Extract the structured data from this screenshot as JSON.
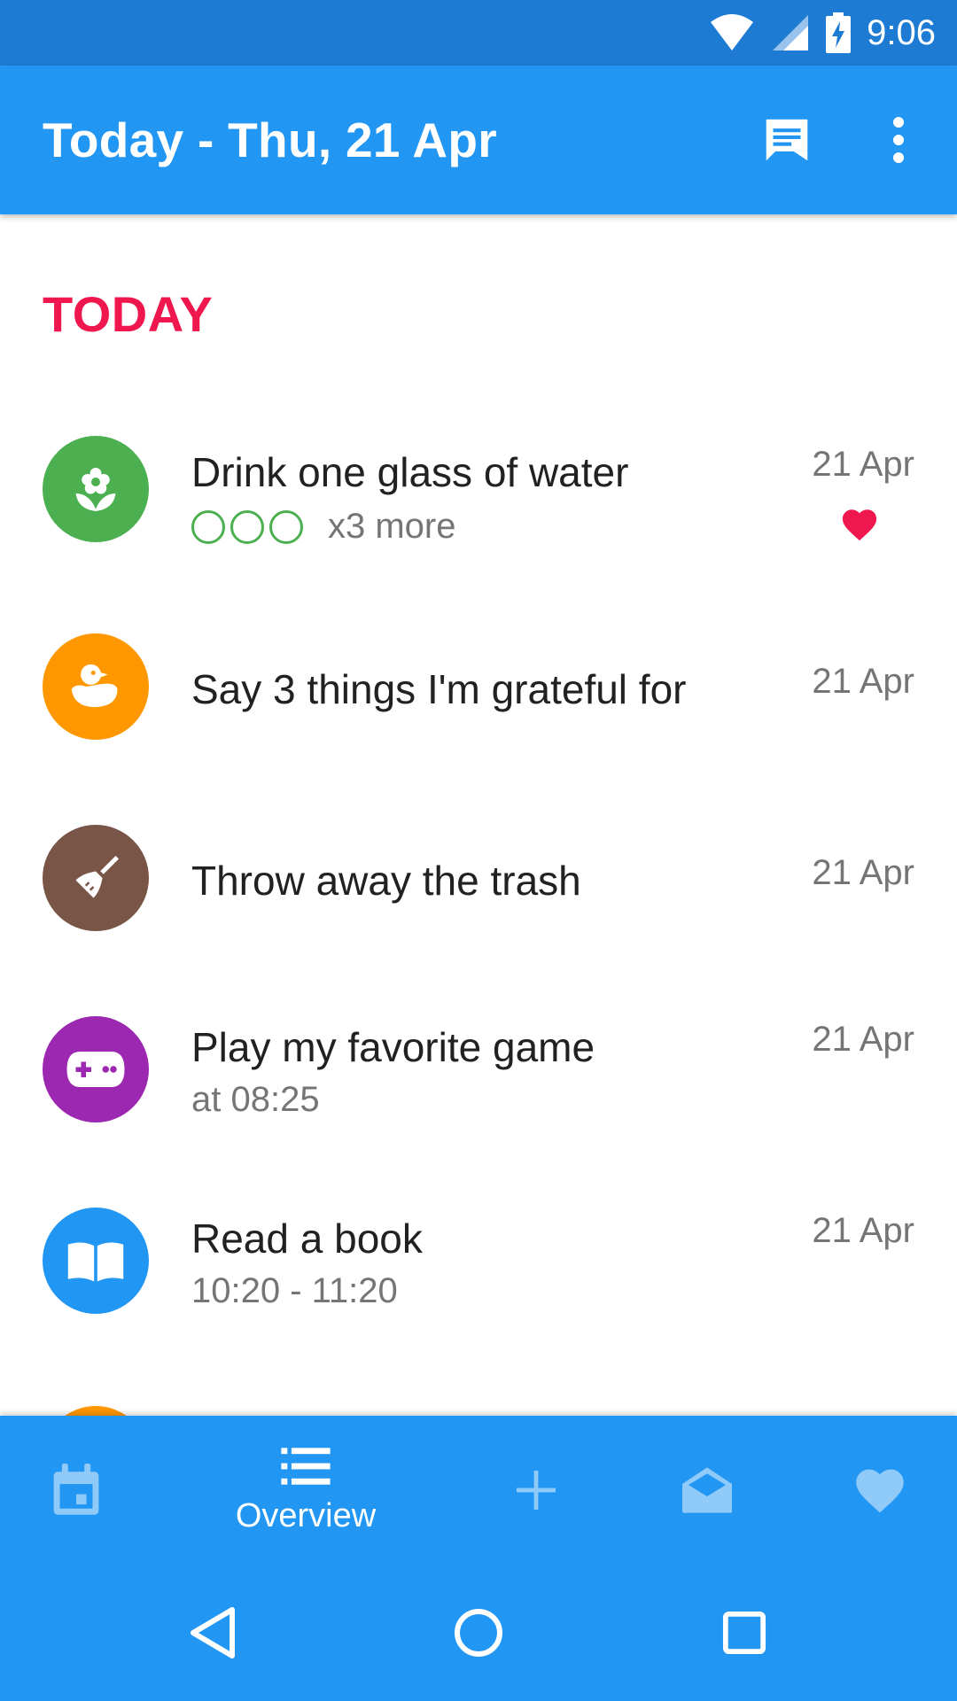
{
  "status_bar": {
    "time": "9:06"
  },
  "app_bar": {
    "title": "Today - Thu, 21 Apr",
    "icons": [
      "chat-icon",
      "more-vert-icon"
    ]
  },
  "section": {
    "header": "TODAY"
  },
  "tasks": [
    {
      "title": "Drink one glass of water",
      "subtitle": "x3 more",
      "date": "21 Apr",
      "icon": "flower-icon",
      "color": "#4CAF50",
      "progress_total": 3,
      "progress_done": 0,
      "favorite": true
    },
    {
      "title": "Say 3 things I'm grateful for",
      "subtitle": "",
      "date": "21 Apr",
      "icon": "duck-icon",
      "color": "#FF9800"
    },
    {
      "title": "Throw away the trash",
      "subtitle": "",
      "date": "21 Apr",
      "icon": "broom-icon",
      "color": "#795548"
    },
    {
      "title": "Play my favorite game",
      "subtitle": "at 08:25",
      "date": "21 Apr",
      "icon": "gamepad-icon",
      "color": "#9C27B0"
    },
    {
      "title": "Read a book",
      "subtitle": "10:20 - 11:20",
      "date": "21 Apr",
      "icon": "book-icon",
      "color": "#2196F3"
    }
  ],
  "bottom_nav": {
    "items": [
      {
        "icon": "calendar-icon",
        "label": ""
      },
      {
        "icon": "list-icon",
        "label": "Overview",
        "active": true
      },
      {
        "icon": "add-icon",
        "label": ""
      },
      {
        "icon": "inbox-icon",
        "label": ""
      },
      {
        "icon": "heart-icon",
        "label": ""
      }
    ]
  },
  "colors": {
    "status_bar": "#1E7BD4",
    "primary": "#2196F3",
    "accent": "#F0174E",
    "heart": "#F0174E"
  }
}
